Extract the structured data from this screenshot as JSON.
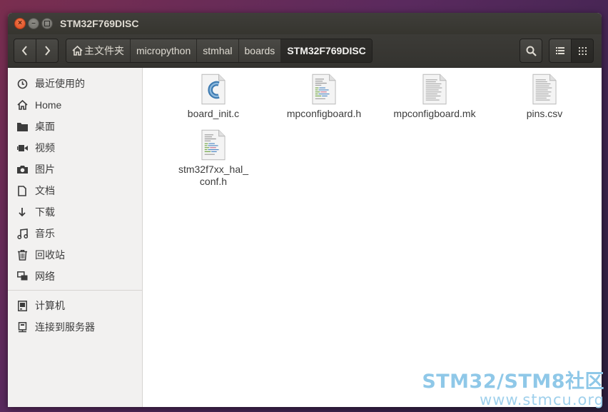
{
  "window": {
    "title": "STM32F769DISC"
  },
  "toolbar": {
    "back_glyph": "‹",
    "forward_glyph": "›",
    "breadcrumb": [
      {
        "label": "主文件夹",
        "icon": "home-icon"
      },
      {
        "label": "micropython"
      },
      {
        "label": "stmhal"
      },
      {
        "label": "boards"
      },
      {
        "label": "STM32F769DISC",
        "active": true
      }
    ]
  },
  "sidebar": {
    "places": [
      {
        "label": "最近使用的",
        "icon": "clock-icon"
      },
      {
        "label": "Home",
        "icon": "home-icon"
      },
      {
        "label": "桌面",
        "icon": "folder-icon"
      },
      {
        "label": "视频",
        "icon": "video-icon"
      },
      {
        "label": "图片",
        "icon": "camera-icon"
      },
      {
        "label": "文档",
        "icon": "document-icon"
      },
      {
        "label": "下载",
        "icon": "download-icon"
      },
      {
        "label": "音乐",
        "icon": "music-icon"
      },
      {
        "label": "回收站",
        "icon": "trash-icon"
      },
      {
        "label": "网络",
        "icon": "network-icon"
      }
    ],
    "devices": [
      {
        "label": "计算机",
        "icon": "computer-icon"
      },
      {
        "label": "连接到服务器",
        "icon": "server-icon"
      }
    ]
  },
  "files": [
    {
      "name": "board_init.c",
      "type": "c-source"
    },
    {
      "name": "mpconfigboard.h",
      "type": "header"
    },
    {
      "name": "mpconfigboard.mk",
      "type": "text"
    },
    {
      "name": "pins.csv",
      "type": "text"
    },
    {
      "name_line1": "stm32f7xx_hal_",
      "name_line2": "conf.h",
      "type": "header"
    }
  ],
  "watermark": {
    "line1": "STM32/STM8社区",
    "line2": "www.stmcu.org"
  },
  "colors": {
    "accent_close": "#dc4a1c",
    "watermark": "#8fc8e8"
  }
}
